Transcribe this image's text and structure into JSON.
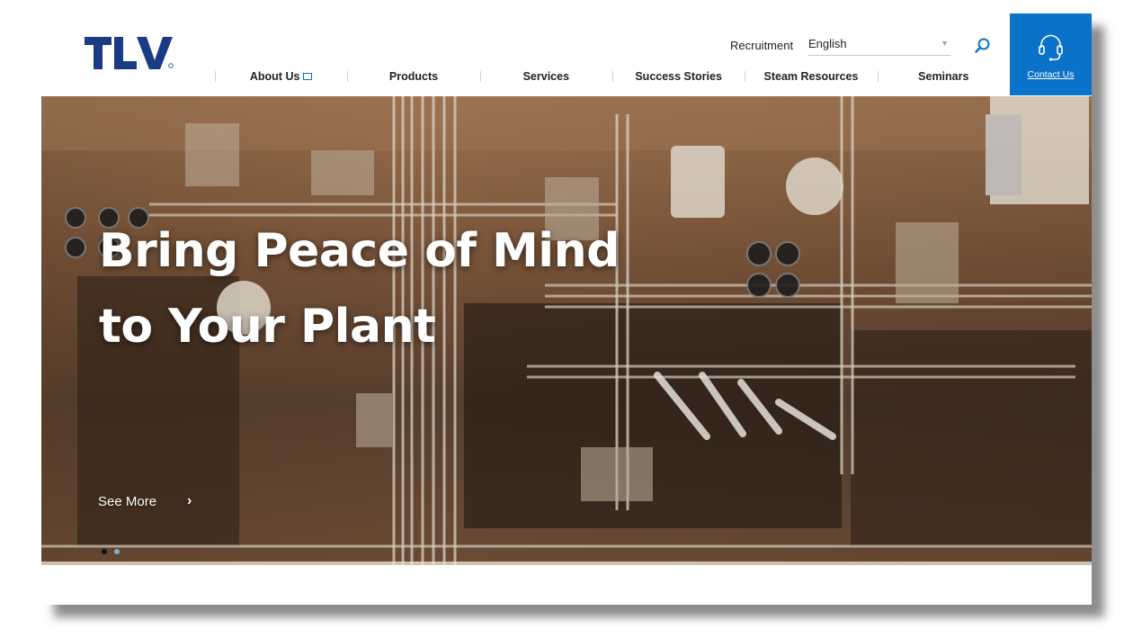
{
  "header": {
    "logo_text": "TLV",
    "utility": {
      "recruitment_label": "Recruitment",
      "language_value": "English"
    },
    "contact": {
      "label": "Contact Us"
    },
    "nav": {
      "items": [
        {
          "label": "About Us",
          "external": true
        },
        {
          "label": "Products"
        },
        {
          "label": "Services"
        },
        {
          "label": "Success Stories"
        },
        {
          "label": "Steam Resources"
        },
        {
          "label": "Seminars"
        }
      ]
    }
  },
  "hero": {
    "headline_line1": "Bring Peace of Mind",
    "headline_line2": "to Your Plant",
    "cta_label": "See More",
    "slides_total": 2,
    "active_slide": 1
  },
  "colors": {
    "brand_blue": "#0a73c9",
    "logo_navy": "#1a3b86"
  }
}
